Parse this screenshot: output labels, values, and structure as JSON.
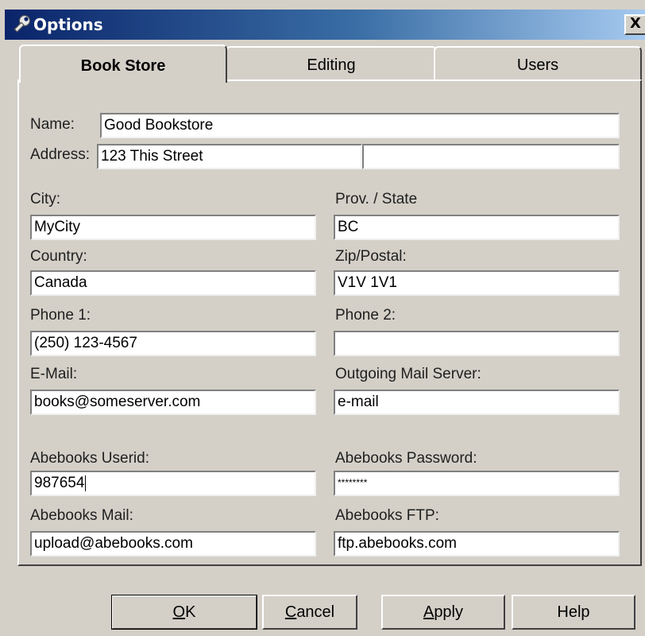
{
  "window": {
    "title": "Options",
    "title_icon": "wrench-icon",
    "close_label": "X",
    "colors": {
      "titlebar_start": "#0a246a",
      "titlebar_end": "#a6caf0",
      "face": "#d4d0c8"
    }
  },
  "tabs": [
    {
      "label": "Book Store",
      "active": true
    },
    {
      "label": "Editing",
      "active": false
    },
    {
      "label": "Users",
      "active": false
    }
  ],
  "form": {
    "name": {
      "label": "Name:",
      "value": "Good Bookstore"
    },
    "address": {
      "label": "Address:",
      "value1": "123 This Street",
      "value2": ""
    },
    "city": {
      "label": "City:",
      "value": "MyCity"
    },
    "prov_state": {
      "label": "Prov. / State",
      "value": "BC"
    },
    "country": {
      "label": "Country:",
      "value": "Canada"
    },
    "zip": {
      "label": "Zip/Postal:",
      "value": "V1V 1V1"
    },
    "phone1": {
      "label": "Phone 1:",
      "value": "(250) 123-4567"
    },
    "phone2": {
      "label": "Phone 2:",
      "value": ""
    },
    "email": {
      "label": "E-Mail:",
      "value": "books@someserver.com"
    },
    "mail_server": {
      "label": "Outgoing Mail Server:",
      "value": "e-mail"
    },
    "abe_userid": {
      "label": "Abebooks Userid:",
      "value": "987654"
    },
    "abe_password": {
      "label": "Abebooks Password:",
      "value": "********"
    },
    "abe_mail": {
      "label": "Abebooks Mail:",
      "value": "upload@abebooks.com"
    },
    "abe_ftp": {
      "label": "Abebooks FTP:",
      "value": "ftp.abebooks.com"
    }
  },
  "buttons": {
    "ok": {
      "accel": "O",
      "rest": "K"
    },
    "cancel": {
      "accel": "C",
      "rest": "ancel"
    },
    "apply": {
      "accel": "A",
      "rest": "pply"
    },
    "help": {
      "label": "Help"
    }
  }
}
